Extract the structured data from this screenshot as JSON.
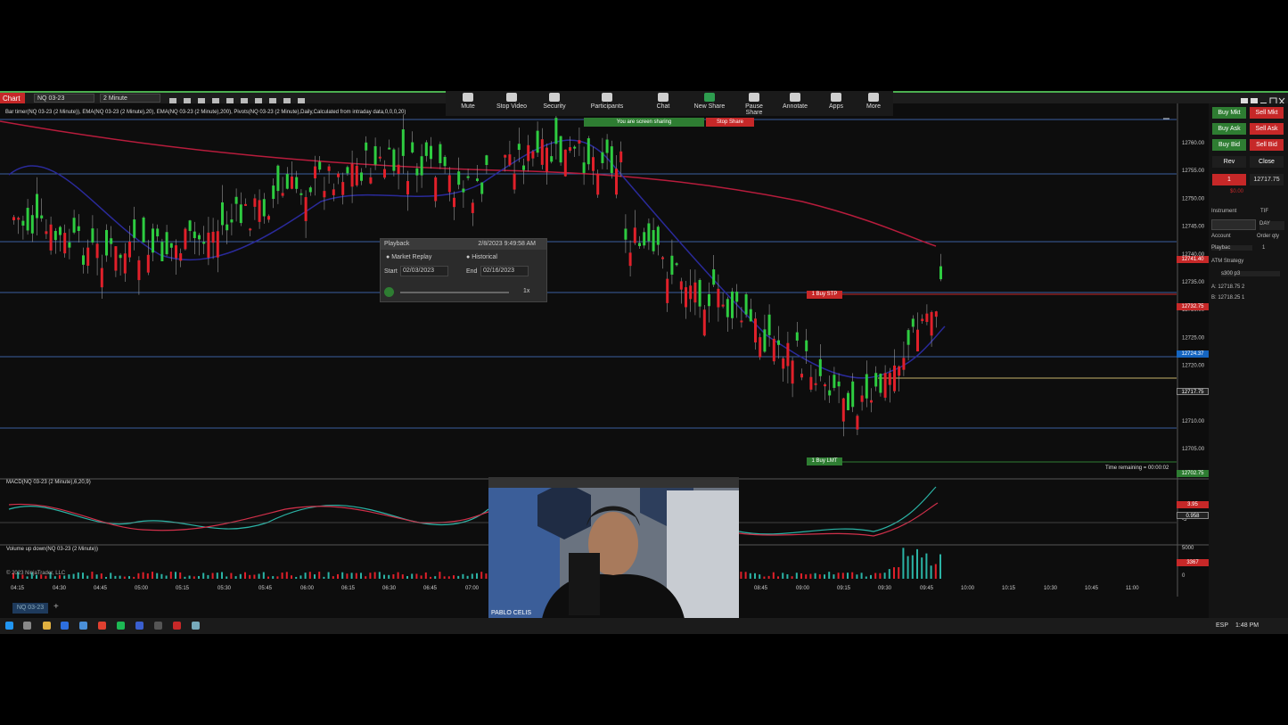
{
  "window": {
    "title": "Chart",
    "instrument": "NQ 03-23",
    "interval": "2 Minute"
  },
  "indicators_line": "Bar timer(NQ 03-23 (2 Minute)), EMA(NQ 03-23 (2 Minute),20), EMA(NQ 03-23 (2 Minute),200), Pivots(NQ 03-23 (2 Minute),Daily,Calculated from intraday data,0,0,0,20)",
  "zoom": {
    "buttons": [
      {
        "label": "Mute",
        "icon": "mic-icon"
      },
      {
        "label": "Stop Video",
        "icon": "video-icon"
      },
      {
        "label": "Security",
        "icon": "shield-icon"
      },
      {
        "label": "Participants",
        "icon": "people-icon"
      },
      {
        "label": "Chat",
        "icon": "chat-icon"
      },
      {
        "label": "New Share",
        "icon": "share-icon"
      },
      {
        "label": "Pause Share",
        "icon": "pause-icon"
      },
      {
        "label": "Annotate",
        "icon": "pencil-icon"
      },
      {
        "label": "Apps",
        "icon": "apps-icon"
      },
      {
        "label": "More",
        "icon": "more-icon"
      }
    ],
    "participants_count": "1",
    "sharing_status": "You are screen sharing",
    "stop_share": "Stop Share"
  },
  "playback": {
    "title": "Playback",
    "datetime": "2/8/2023 9:49:58 AM",
    "mode_market": "Market Replay",
    "mode_historical": "Historical",
    "start_label": "Start",
    "start_value": "02/03/2023",
    "end_label": "End",
    "end_value": "02/16/2023",
    "speed": "1x"
  },
  "price_axis": [
    "12760.00",
    "12755.00",
    "12750.00",
    "12745.00",
    "12740.00",
    "12735.00",
    "12730.00",
    "12725.00",
    "12720.00",
    "12715.00",
    "12710.00",
    "12705.00"
  ],
  "price_tags": [
    {
      "value": "12741.40",
      "color": "#c62828"
    },
    {
      "value": "12732.75",
      "color": "#c62828"
    },
    {
      "value": "12724.37",
      "color": "#1565c0"
    },
    {
      "value": "12717.75",
      "color": "#222222"
    },
    {
      "value": "12702.75",
      "color": "#2e7d32"
    }
  ],
  "orders": {
    "buy_stp": "1 Buy STP",
    "buy_lmt": "1 Buy LMT"
  },
  "time_remaining": "Time remaining = 00:00:02",
  "macd": {
    "label": "MACD(NQ 03-23 (2 Minute),6,20,9)",
    "tag1": "3.95",
    "tag2": "0.958",
    "axis_lo": "-5"
  },
  "volume": {
    "label": "Volume up down(NQ 03-23 (2 Minute))",
    "tag": "3367",
    "axis_hi": "5000",
    "axis_lo": "0"
  },
  "copyright": "© 2023 NinjaTrader, LLC",
  "time_axis": [
    "04:15",
    "04:30",
    "04:45",
    "05:00",
    "05:15",
    "05:30",
    "05:45",
    "06:00",
    "06:15",
    "06:30",
    "06:45",
    "07:00",
    "08:45",
    "09:00",
    "09:15",
    "09:30",
    "09:45",
    "10:00",
    "10:15",
    "10:30",
    "10:45",
    "11:00"
  ],
  "bottom_tab": "NQ 03-23",
  "order_panel": {
    "buy_mkt": "Buy Mkt",
    "sell_mkt": "Sell Mkt",
    "buy_ask": "Buy Ask",
    "sell_ask": "Sell Ask",
    "buy_bid": "Buy Bid",
    "sell_bid": "Sell Bid",
    "rev": "Rev",
    "close": "Close",
    "position_qty": "1",
    "position_price": "12717.75",
    "pnl": "$0.00",
    "instrument_label": "Instrument",
    "tif_label": "TIF",
    "tif_value": "DAY",
    "account_label": "Account",
    "order_qty_label": "Order qty",
    "account_value": "Playbac",
    "order_qty": "1",
    "atm_label": "ATM Strategy",
    "atm_value": "s300 p3",
    "ask_row": "A: 12718.75  2",
    "bid_row": "B: 12718.25  1"
  },
  "webcam": {
    "name": "PABLO CELIS"
  },
  "taskbar": {
    "lang": "ESP",
    "time": "1:48 PM"
  }
}
